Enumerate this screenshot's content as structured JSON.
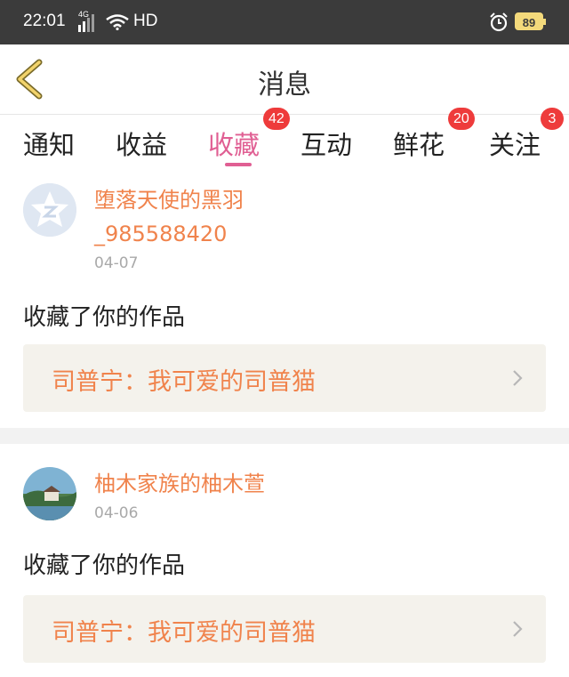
{
  "status_bar": {
    "time": "22:01",
    "network": "4G",
    "hd": "HD",
    "battery": "89"
  },
  "header": {
    "title": "消息"
  },
  "tabs": [
    {
      "label": "通知",
      "badge": ""
    },
    {
      "label": "收益",
      "badge": ""
    },
    {
      "label": "收藏",
      "badge": "42",
      "active": true
    },
    {
      "label": "互动",
      "badge": ""
    },
    {
      "label": "鲜花",
      "badge": "20"
    },
    {
      "label": "关注",
      "badge": "3"
    }
  ],
  "items": [
    {
      "user": "堕落天使的黑羽_985588420",
      "date": "04-07",
      "action": "收藏了你的作品",
      "work": "司普宁：我可爱的司普猫"
    },
    {
      "user": "柚木家族的柚木萱",
      "date": "04-06",
      "action": "收藏了你的作品",
      "work": "司普宁：我可爱的司普猫"
    }
  ],
  "colors": {
    "accent": "#e05f93",
    "name": "#f0834c",
    "badge": "#ee3b3b"
  }
}
